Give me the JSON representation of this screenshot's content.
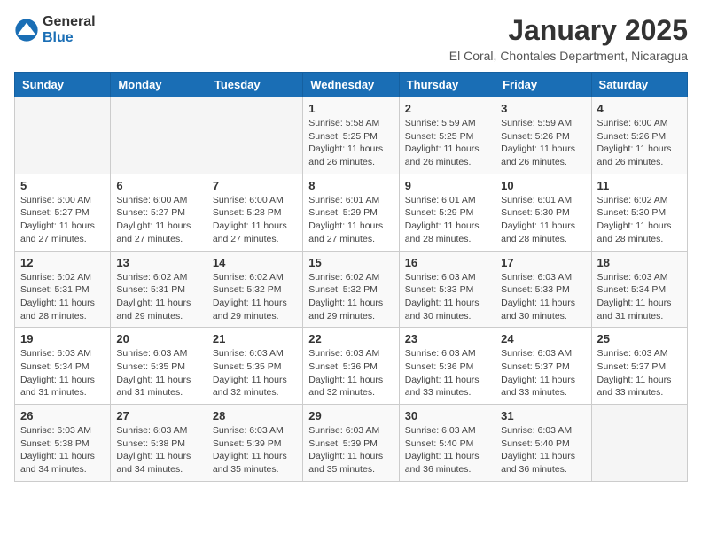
{
  "logo": {
    "general": "General",
    "blue": "Blue"
  },
  "title": "January 2025",
  "location": "El Coral, Chontales Department, Nicaragua",
  "days_header": [
    "Sunday",
    "Monday",
    "Tuesday",
    "Wednesday",
    "Thursday",
    "Friday",
    "Saturday"
  ],
  "weeks": [
    [
      {
        "day": "",
        "info": ""
      },
      {
        "day": "",
        "info": ""
      },
      {
        "day": "",
        "info": ""
      },
      {
        "day": "1",
        "info": "Sunrise: 5:58 AM\nSunset: 5:25 PM\nDaylight: 11 hours and 26 minutes."
      },
      {
        "day": "2",
        "info": "Sunrise: 5:59 AM\nSunset: 5:25 PM\nDaylight: 11 hours and 26 minutes."
      },
      {
        "day": "3",
        "info": "Sunrise: 5:59 AM\nSunset: 5:26 PM\nDaylight: 11 hours and 26 minutes."
      },
      {
        "day": "4",
        "info": "Sunrise: 6:00 AM\nSunset: 5:26 PM\nDaylight: 11 hours and 26 minutes."
      }
    ],
    [
      {
        "day": "5",
        "info": "Sunrise: 6:00 AM\nSunset: 5:27 PM\nDaylight: 11 hours and 27 minutes."
      },
      {
        "day": "6",
        "info": "Sunrise: 6:00 AM\nSunset: 5:27 PM\nDaylight: 11 hours and 27 minutes."
      },
      {
        "day": "7",
        "info": "Sunrise: 6:00 AM\nSunset: 5:28 PM\nDaylight: 11 hours and 27 minutes."
      },
      {
        "day": "8",
        "info": "Sunrise: 6:01 AM\nSunset: 5:29 PM\nDaylight: 11 hours and 27 minutes."
      },
      {
        "day": "9",
        "info": "Sunrise: 6:01 AM\nSunset: 5:29 PM\nDaylight: 11 hours and 28 minutes."
      },
      {
        "day": "10",
        "info": "Sunrise: 6:01 AM\nSunset: 5:30 PM\nDaylight: 11 hours and 28 minutes."
      },
      {
        "day": "11",
        "info": "Sunrise: 6:02 AM\nSunset: 5:30 PM\nDaylight: 11 hours and 28 minutes."
      }
    ],
    [
      {
        "day": "12",
        "info": "Sunrise: 6:02 AM\nSunset: 5:31 PM\nDaylight: 11 hours and 28 minutes."
      },
      {
        "day": "13",
        "info": "Sunrise: 6:02 AM\nSunset: 5:31 PM\nDaylight: 11 hours and 29 minutes."
      },
      {
        "day": "14",
        "info": "Sunrise: 6:02 AM\nSunset: 5:32 PM\nDaylight: 11 hours and 29 minutes."
      },
      {
        "day": "15",
        "info": "Sunrise: 6:02 AM\nSunset: 5:32 PM\nDaylight: 11 hours and 29 minutes."
      },
      {
        "day": "16",
        "info": "Sunrise: 6:03 AM\nSunset: 5:33 PM\nDaylight: 11 hours and 30 minutes."
      },
      {
        "day": "17",
        "info": "Sunrise: 6:03 AM\nSunset: 5:33 PM\nDaylight: 11 hours and 30 minutes."
      },
      {
        "day": "18",
        "info": "Sunrise: 6:03 AM\nSunset: 5:34 PM\nDaylight: 11 hours and 31 minutes."
      }
    ],
    [
      {
        "day": "19",
        "info": "Sunrise: 6:03 AM\nSunset: 5:34 PM\nDaylight: 11 hours and 31 minutes."
      },
      {
        "day": "20",
        "info": "Sunrise: 6:03 AM\nSunset: 5:35 PM\nDaylight: 11 hours and 31 minutes."
      },
      {
        "day": "21",
        "info": "Sunrise: 6:03 AM\nSunset: 5:35 PM\nDaylight: 11 hours and 32 minutes."
      },
      {
        "day": "22",
        "info": "Sunrise: 6:03 AM\nSunset: 5:36 PM\nDaylight: 11 hours and 32 minutes."
      },
      {
        "day": "23",
        "info": "Sunrise: 6:03 AM\nSunset: 5:36 PM\nDaylight: 11 hours and 33 minutes."
      },
      {
        "day": "24",
        "info": "Sunrise: 6:03 AM\nSunset: 5:37 PM\nDaylight: 11 hours and 33 minutes."
      },
      {
        "day": "25",
        "info": "Sunrise: 6:03 AM\nSunset: 5:37 PM\nDaylight: 11 hours and 33 minutes."
      }
    ],
    [
      {
        "day": "26",
        "info": "Sunrise: 6:03 AM\nSunset: 5:38 PM\nDaylight: 11 hours and 34 minutes."
      },
      {
        "day": "27",
        "info": "Sunrise: 6:03 AM\nSunset: 5:38 PM\nDaylight: 11 hours and 34 minutes."
      },
      {
        "day": "28",
        "info": "Sunrise: 6:03 AM\nSunset: 5:39 PM\nDaylight: 11 hours and 35 minutes."
      },
      {
        "day": "29",
        "info": "Sunrise: 6:03 AM\nSunset: 5:39 PM\nDaylight: 11 hours and 35 minutes."
      },
      {
        "day": "30",
        "info": "Sunrise: 6:03 AM\nSunset: 5:40 PM\nDaylight: 11 hours and 36 minutes."
      },
      {
        "day": "31",
        "info": "Sunrise: 6:03 AM\nSunset: 5:40 PM\nDaylight: 11 hours and 36 minutes."
      },
      {
        "day": "",
        "info": ""
      }
    ]
  ]
}
